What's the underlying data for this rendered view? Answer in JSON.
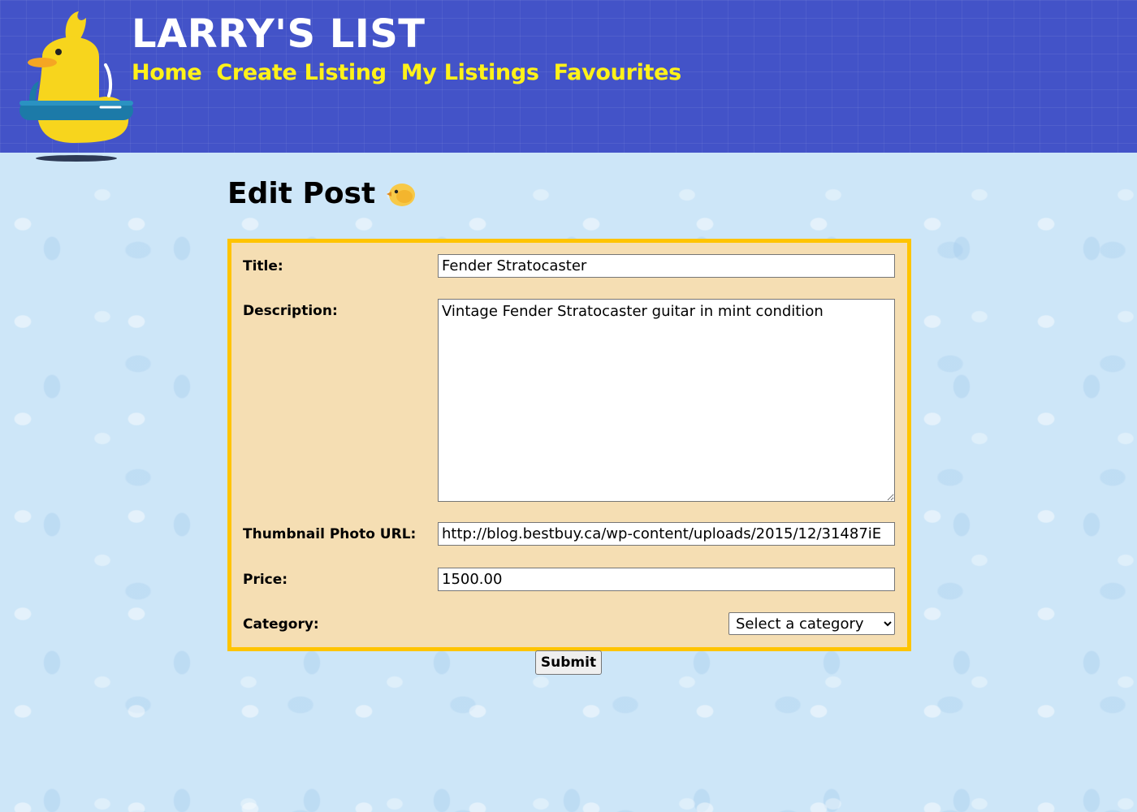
{
  "header": {
    "site_title": "LARRY'S LIST",
    "logo_icon": "rubber-duck-icon",
    "nav": [
      {
        "label": "Home"
      },
      {
        "label": "Create Listing"
      },
      {
        "label": "My Listings"
      },
      {
        "label": "Favourites"
      }
    ]
  },
  "main": {
    "heading": "Edit Post",
    "heading_icon": "baby-chick-icon",
    "form": {
      "title": {
        "label": "Title:",
        "value": "Fender Stratocaster"
      },
      "description": {
        "label": "Description:",
        "value": "Vintage Fender Stratocaster guitar in mint condition"
      },
      "thumbnail": {
        "label": "Thumbnail Photo URL:",
        "value": "http://blog.bestbuy.ca/wp-content/uploads/2015/12/31487iE"
      },
      "price": {
        "label": "Price:",
        "value": "1500.00"
      },
      "category": {
        "label": "Category:",
        "selected": "Select a category"
      },
      "submit_label": "Submit"
    }
  },
  "colors": {
    "header_bg": "#4353c8",
    "nav_link": "#fff219",
    "page_bg": "#cde6f8",
    "form_bg": "#f5deb3",
    "form_border": "#ffc400"
  }
}
